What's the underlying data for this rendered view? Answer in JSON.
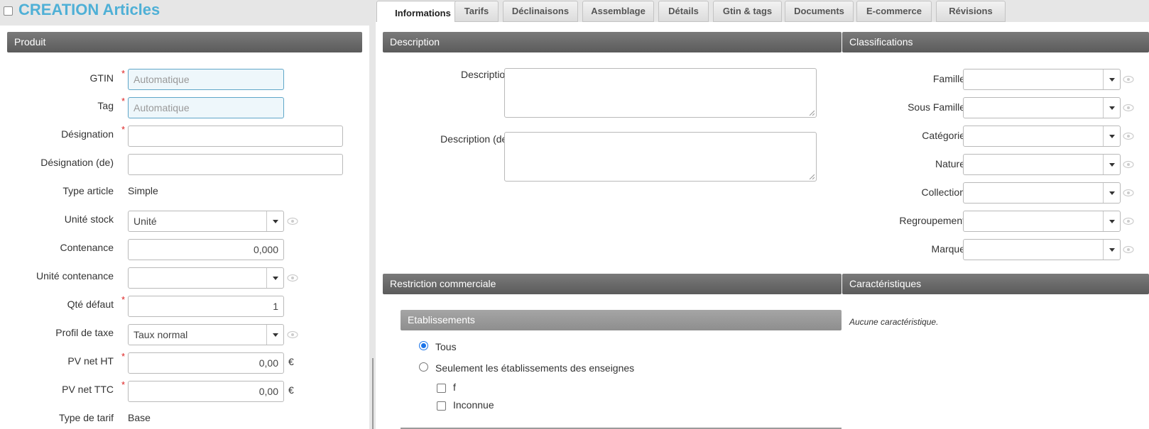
{
  "header": {
    "title": "CREATION Articles"
  },
  "tabs": [
    {
      "label": "Informations",
      "active": true
    },
    {
      "label": "Tarifs"
    },
    {
      "label": "Déclinaisons"
    },
    {
      "label": "Assemblage"
    },
    {
      "label": "Détails"
    },
    {
      "label": "Gtin & tags"
    },
    {
      "label": "Documents"
    },
    {
      "label": "E-commerce"
    },
    {
      "label": "Révisions"
    }
  ],
  "produit": {
    "title": "Produit",
    "gtin": {
      "label": "GTIN",
      "placeholder": "Automatique"
    },
    "tag": {
      "label": "Tag",
      "placeholder": "Automatique"
    },
    "designation": {
      "label": "Désignation",
      "value": ""
    },
    "designation_de": {
      "label": "Désignation (de)",
      "value": ""
    },
    "type_article": {
      "label": "Type article",
      "value": "Simple"
    },
    "unite_stock": {
      "label": "Unité stock",
      "value": "Unité"
    },
    "contenance": {
      "label": "Contenance",
      "value": "0,000"
    },
    "unite_contenance": {
      "label": "Unité contenance",
      "value": ""
    },
    "qte_defaut": {
      "label": "Qté défaut",
      "value": "1"
    },
    "profil_taxe": {
      "label": "Profil de taxe",
      "value": "Taux normal"
    },
    "pv_net_ht": {
      "label": "PV net HT",
      "value": "0,00",
      "unit": "€"
    },
    "pv_net_ttc": {
      "label": "PV net TTC",
      "value": "0,00",
      "unit": "€"
    },
    "type_tarif": {
      "label": "Type de tarif",
      "value": "Base"
    }
  },
  "description": {
    "title": "Description",
    "fields": [
      {
        "label": "Description",
        "value": ""
      },
      {
        "label": "Description (de)",
        "value": ""
      }
    ]
  },
  "classifications": {
    "title": "Classifications",
    "fields": [
      {
        "label": "Famille",
        "value": ""
      },
      {
        "label": "Sous Famille",
        "value": ""
      },
      {
        "label": "Catégorie",
        "value": ""
      },
      {
        "label": "Nature",
        "value": ""
      },
      {
        "label": "Collection",
        "value": ""
      },
      {
        "label": "Regroupement",
        "value": ""
      },
      {
        "label": "Marque",
        "value": ""
      }
    ]
  },
  "restriction": {
    "title": "Restriction commerciale",
    "etablissements": {
      "title": "Etablissements",
      "options": [
        {
          "label": "Tous",
          "checked": true
        },
        {
          "label": "Seulement les établissements des enseignes",
          "checked": false
        }
      ],
      "enseignes": [
        {
          "label": "f",
          "checked": false
        },
        {
          "label": "Inconnue",
          "checked": false
        }
      ]
    }
  },
  "caracteristiques": {
    "title": "Caractéristiques",
    "empty_text": "Aucune caractéristique."
  },
  "colors": {
    "accent": "#4fb0d6",
    "required": "#dd2222",
    "radio_active": "#1a73e8"
  }
}
